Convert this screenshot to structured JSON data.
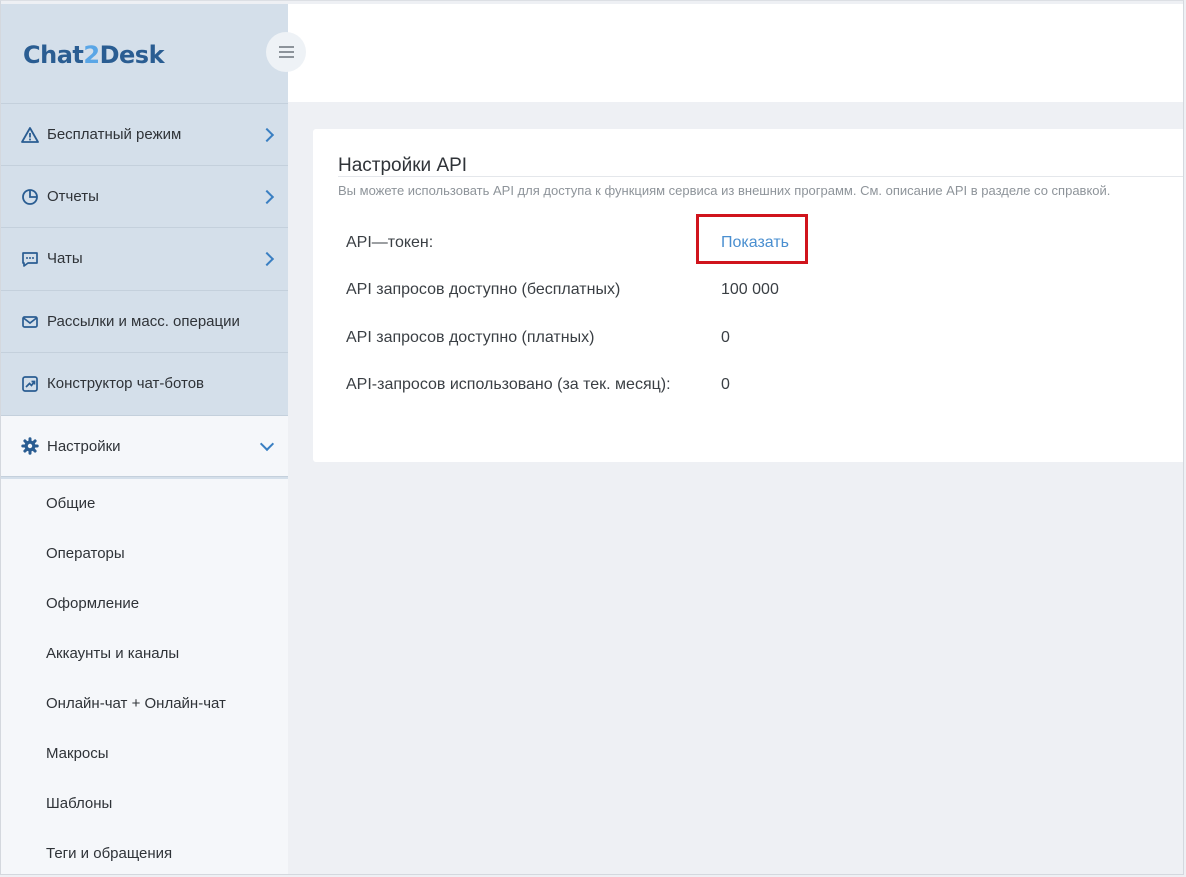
{
  "brand": {
    "logo_part1": "Chat",
    "logo_part2": "2",
    "logo_part3": "Desk"
  },
  "sidebar": {
    "items": [
      {
        "label": "Бесплатный режим",
        "icon": "warning-icon"
      },
      {
        "label": "Отчеты",
        "icon": "pie-chart-icon"
      },
      {
        "label": "Чаты",
        "icon": "chat-icon"
      },
      {
        "label": "Рассылки и масс. операции",
        "icon": "envelope-icon"
      },
      {
        "label": "Конструктор чат-ботов",
        "icon": "chart-arrow-icon"
      },
      {
        "label": "Настройки",
        "icon": "gear-icon"
      }
    ],
    "subitems": [
      "Общие",
      "Операторы",
      "Оформление",
      "Аккаунты и каналы",
      "Онлайн-чат + Онлайн-чат",
      "Макросы",
      "Шаблоны",
      "Теги и обращения"
    ]
  },
  "api_settings": {
    "title": "Настройки API",
    "description": "Вы можете использовать API для доступа к функциям сервиса из внешних программ. См. описание API в разделе со справкой.",
    "rows": [
      {
        "label": "API—токен:",
        "value": "Показать"
      },
      {
        "label": "API запросов доступно (бесплатных)",
        "value": "100 000"
      },
      {
        "label": "API запросов доступно (платных)",
        "value": "0"
      },
      {
        "label": "API-запросов использовано (за тек. месяц):",
        "value": "0"
      }
    ]
  },
  "colors": {
    "accent": "#3a7fc2",
    "link": "#4a8fd0",
    "highlight": "#d0141c",
    "sidebar_top": "#d4dfea"
  }
}
